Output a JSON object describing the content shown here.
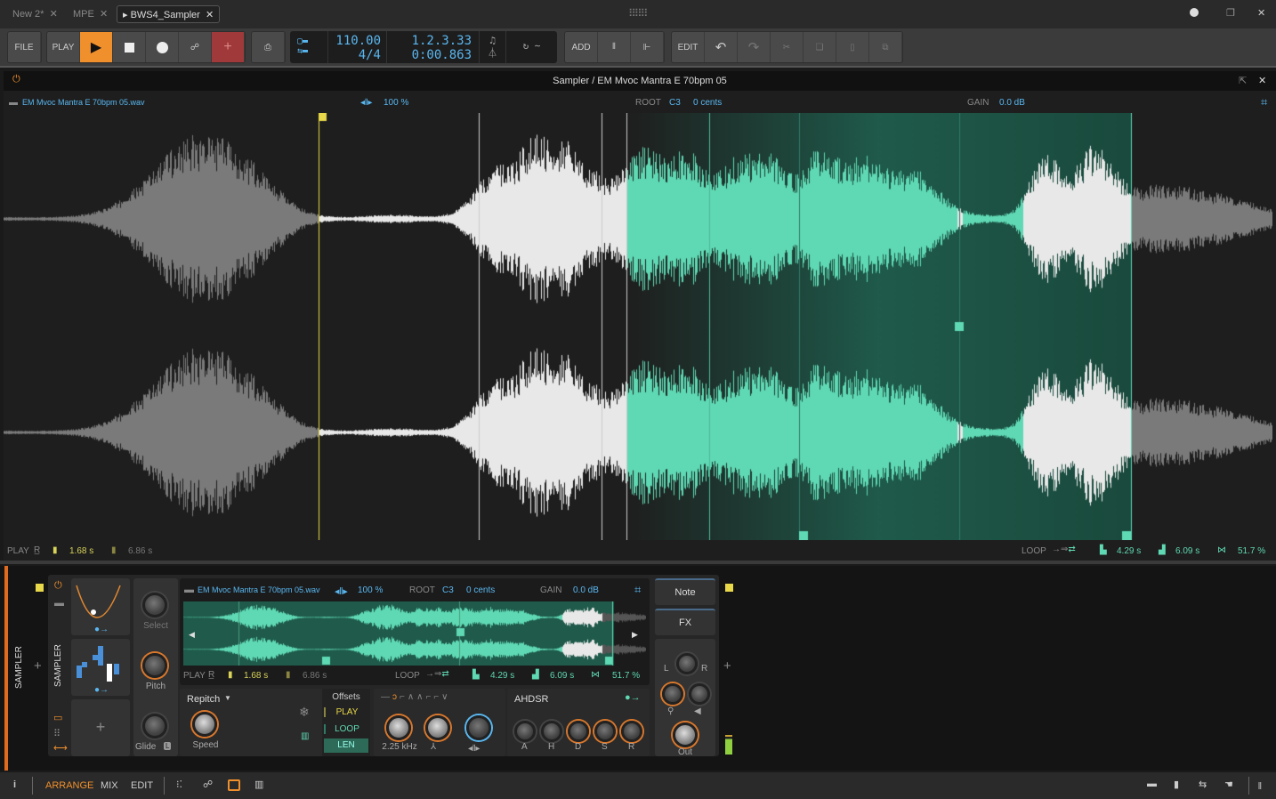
{
  "tabs": [
    {
      "label": "New 2*"
    },
    {
      "label": "MPE"
    },
    {
      "label": "BWS4_Sampler",
      "active": true
    }
  ],
  "toolbar": {
    "file": "FILE",
    "play_menu": "PLAY",
    "add": "ADD",
    "edit": "EDIT",
    "tempo": "110.00",
    "signature": "4/4",
    "position_bars": "1.2.3.33",
    "position_time": "0:00.863"
  },
  "colors": {
    "accent": "#f0902c",
    "record_arm": "#a03a3a",
    "teal": "#5fd9b3",
    "blue": "#59b7f0",
    "marker_yellow": "#e8d84a"
  },
  "editor": {
    "title": "Sampler / EM Mvoc Mantra E 70bpm 05",
    "file": "EM Mvoc Mantra E 70bpm 05.wav",
    "speed": "100 %",
    "root_label": "ROOT",
    "root": "C3",
    "cents": "0 cents",
    "gain_label": "GAIN",
    "gain": "0.0 dB",
    "footer": {
      "play_label": "PLAY",
      "start": "1.68 s",
      "end": "6.86 s",
      "loop_label": "LOOP",
      "loop_start": "4.29 s",
      "loop_end": "6.09 s",
      "crossfade": "51.7 %"
    }
  },
  "device": {
    "name": "SAMPLER",
    "chain_label": "SAMPLER",
    "select": "Select",
    "pitch": "Pitch",
    "glide": "Glide",
    "glide_badge": "L",
    "file": "EM Mvoc Mantra E 70bpm 05.wav",
    "speed": "100 %",
    "root_label": "ROOT",
    "root": "C3",
    "cents": "0 cents",
    "gain_label": "GAIN",
    "gain": "0.0 dB",
    "play_label": "PLAY",
    "start": "1.68 s",
    "end": "6.86 s",
    "loop_label": "LOOP",
    "loop_start": "4.29 s",
    "loop_end": "6.09 s",
    "crossfade": "51.7 %",
    "mode": "Repitch",
    "speed_knob": "Speed",
    "offsets": "Offsets",
    "offset_play": "PLAY",
    "offset_loop": "LOOP",
    "offset_len": "LEN",
    "cutoff": "2.25 kHz",
    "env_mode": "AHDSR",
    "env": [
      "A",
      "H",
      "D",
      "S",
      "R"
    ],
    "note": "Note",
    "fx": "FX",
    "pan_l": "L",
    "pan_r": "R",
    "out": "Out"
  },
  "bottombar": {
    "arrange": "ARRANGE",
    "mix": "MIX",
    "edit": "EDIT"
  }
}
